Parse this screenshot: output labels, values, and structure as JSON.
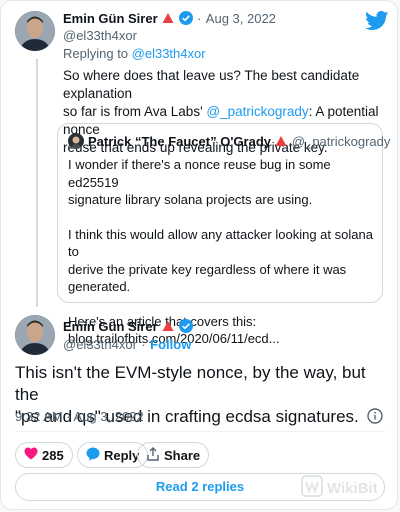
{
  "tweet1": {
    "author_name": "Emin Gün Sirer",
    "date": "Aug 3, 2022",
    "sep": "·",
    "handle": "@el33th4xor",
    "reply_prefix": "Replying to ",
    "reply_handle": "@el33th4xor",
    "text_line1": "So where does that leave us? The best candidate explanation",
    "text_line2_a": "so far is from Ava Labs' ",
    "text_line2_mention": "@_patrickogrady",
    "text_line2_b": ": A potential nonce",
    "text_line3": "reuse that ends up revealing the private key."
  },
  "quote": {
    "author_name": "Patrick “The Faucet” O'Grady",
    "handle": "@_patrickogrady",
    "line1": "I wonder if there's a nonce reuse bug in some ed25519",
    "line2": "signature library solana projects are using.",
    "line3": "I think this would allow any attacker looking at solana to",
    "line4": "derive the private key regardless of where it was",
    "line5": "generated.",
    "line6": "Here's an article that covers this:",
    "line7": "blog.trailofbits.com/2020/06/11/ecd..."
  },
  "tweet2": {
    "author_name": "Emin Gün Sirer",
    "handle": "@el33th4xor",
    "sep": "·",
    "follow_label": "Follow",
    "text_line1": "This isn't the EVM-style nonce, by the way, but the",
    "text_line2": "\"ps and qs\" used in crafting ecdsa signatures.",
    "timestamp": "9:32 AM · Aug 3, 2022"
  },
  "actions": {
    "like_count": "285",
    "reply_label": "Reply",
    "share_label": "Share",
    "read_replies_label": "Read 2 replies"
  },
  "watermark": {
    "text": "WikiBit"
  },
  "colors": {
    "accent": "#1d9bf0",
    "like": "#f91880",
    "verified": "#1d9bf0",
    "flag": "#e84142"
  },
  "icons": [
    "twitter-bird-icon",
    "verified-badge-icon",
    "red-triangle-icon",
    "info-icon",
    "heart-icon",
    "reply-bubble-icon",
    "share-icon"
  ]
}
